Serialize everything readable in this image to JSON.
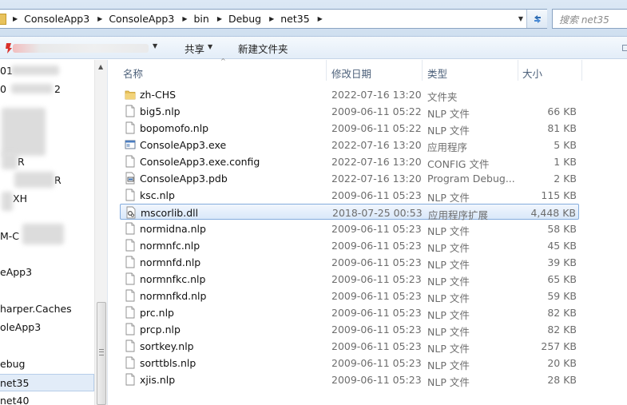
{
  "address_bar": {
    "crumbs": [
      "ConsoleApp3",
      "ConsoleApp3",
      "bin",
      "Debug",
      "net35"
    ],
    "search_placeholder": "搜索 net35"
  },
  "toolbar": {
    "share_label": "共享",
    "new_folder_label": "新建文件夹"
  },
  "nav": {
    "visible_items": [
      "eApp3",
      "harper.Caches",
      "oleApp3",
      "ebug",
      "net35",
      "net40"
    ],
    "partial_items": [
      "01",
      "0",
      "2",
      "R",
      "R",
      "XH",
      "M-C"
    ],
    "selected": "net35"
  },
  "columns": {
    "name": "名称",
    "date": "修改日期",
    "type": "类型",
    "size": "大小"
  },
  "files": [
    {
      "name": "zh-CHS",
      "date": "2022-07-16 13:20",
      "type": "文件夹",
      "size": "",
      "icon": "folder-icon"
    },
    {
      "name": "big5.nlp",
      "date": "2009-06-11 05:22",
      "type": "NLP 文件",
      "size": "66 KB",
      "icon": "file-icon"
    },
    {
      "name": "bopomofo.nlp",
      "date": "2009-06-11 05:22",
      "type": "NLP 文件",
      "size": "81 KB",
      "icon": "file-icon"
    },
    {
      "name": "ConsoleApp3.exe",
      "date": "2022-07-16 13:20",
      "type": "应用程序",
      "size": "5 KB",
      "icon": "exe-icon"
    },
    {
      "name": "ConsoleApp3.exe.config",
      "date": "2022-07-16 13:20",
      "type": "CONFIG 文件",
      "size": "1 KB",
      "icon": "file-icon"
    },
    {
      "name": "ConsoleApp3.pdb",
      "date": "2022-07-16 13:20",
      "type": "Program Debug...",
      "size": "2 KB",
      "icon": "pdb-icon"
    },
    {
      "name": "ksc.nlp",
      "date": "2009-06-11 05:23",
      "type": "NLP 文件",
      "size": "115 KB",
      "icon": "file-icon"
    },
    {
      "name": "mscorlib.dll",
      "date": "2018-07-25 00:53",
      "type": "应用程序扩展",
      "size": "4,448 KB",
      "icon": "dll-icon"
    },
    {
      "name": "normidna.nlp",
      "date": "2009-06-11 05:23",
      "type": "NLP 文件",
      "size": "58 KB",
      "icon": "file-icon"
    },
    {
      "name": "normnfc.nlp",
      "date": "2009-06-11 05:23",
      "type": "NLP 文件",
      "size": "45 KB",
      "icon": "file-icon"
    },
    {
      "name": "normnfd.nlp",
      "date": "2009-06-11 05:23",
      "type": "NLP 文件",
      "size": "39 KB",
      "icon": "file-icon"
    },
    {
      "name": "normnfkc.nlp",
      "date": "2009-06-11 05:23",
      "type": "NLP 文件",
      "size": "65 KB",
      "icon": "file-icon"
    },
    {
      "name": "normnfkd.nlp",
      "date": "2009-06-11 05:23",
      "type": "NLP 文件",
      "size": "59 KB",
      "icon": "file-icon"
    },
    {
      "name": "prc.nlp",
      "date": "2009-06-11 05:23",
      "type": "NLP 文件",
      "size": "82 KB",
      "icon": "file-icon"
    },
    {
      "name": "prcp.nlp",
      "date": "2009-06-11 05:23",
      "type": "NLP 文件",
      "size": "82 KB",
      "icon": "file-icon"
    },
    {
      "name": "sortkey.nlp",
      "date": "2009-06-11 05:23",
      "type": "NLP 文件",
      "size": "257 KB",
      "icon": "file-icon"
    },
    {
      "name": "sorttbls.nlp",
      "date": "2009-06-11 05:23",
      "type": "NLP 文件",
      "size": "20 KB",
      "icon": "file-icon"
    },
    {
      "name": "xjis.nlp",
      "date": "2009-06-11 05:23",
      "type": "NLP 文件",
      "size": "28 KB",
      "icon": "file-icon"
    }
  ],
  "selected_file": "mscorlib.dll",
  "colors": {
    "selection_border": "#84acdd",
    "header_text": "#4c607a",
    "secondary_text": "#6d6d6d",
    "folder": "#e8c25c"
  }
}
